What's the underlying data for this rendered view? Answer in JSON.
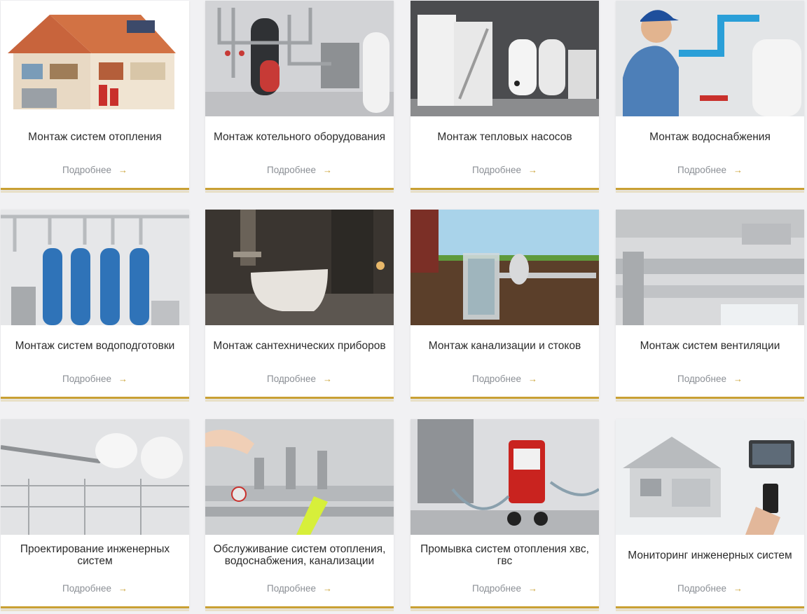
{
  "colors": {
    "accent": "#c9a033",
    "background": "#f1f1f3",
    "card": "#ffffff",
    "title": "#2b2b2b",
    "link": "#8b8f95"
  },
  "cards": [
    {
      "title": "Монтаж систем отопления",
      "link": "Подробнее",
      "image": "house-heating-cutaway"
    },
    {
      "title": "Монтаж котельного оборудования",
      "link": "Подробнее",
      "image": "boiler-room-equipment"
    },
    {
      "title": "Монтаж тепловых насосов",
      "link": "Подробнее",
      "image": "heat-pump-room"
    },
    {
      "title": "Монтаж водоснабжения",
      "link": "Подробнее",
      "image": "plumber-installing-pipes"
    },
    {
      "title": "Монтаж систем водоподготовки",
      "link": "Подробнее",
      "image": "water-filter-tanks"
    },
    {
      "title": "Монтаж сантехнических приборов",
      "link": "Подробнее",
      "image": "bathroom-bathtub"
    },
    {
      "title": "Монтаж канализации и стоков",
      "link": "Подробнее",
      "image": "septic-tank-cutaway"
    },
    {
      "title": "Монтаж систем вентиляции",
      "link": "Подробнее",
      "image": "ventilation-ducts"
    },
    {
      "title": "Проектирование инженерных систем",
      "link": "Подробнее",
      "image": "blueprints-compass"
    },
    {
      "title": "Обслуживание систем отопления, водоснабжения, канализации",
      "link": "Подробнее",
      "image": "manifold-wrench"
    },
    {
      "title": "Промывка систем отопления хвс, гвс",
      "link": "Подробнее",
      "image": "flushing-pump-machine"
    },
    {
      "title": "Мониторинг инженерных систем",
      "link": "Подробнее",
      "image": "smart-home-monitoring"
    }
  ]
}
